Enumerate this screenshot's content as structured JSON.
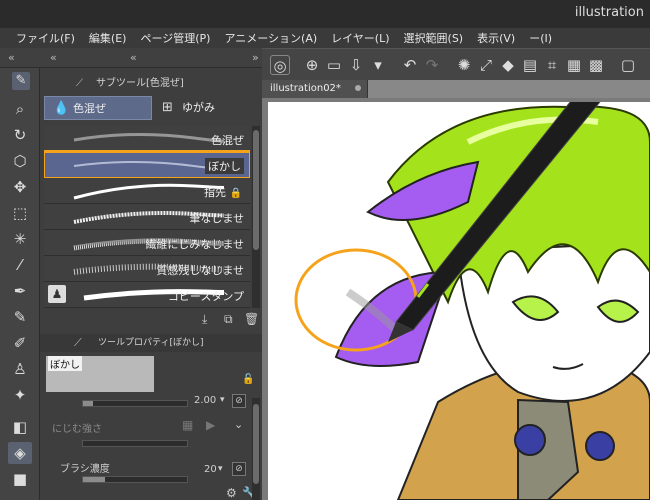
{
  "window": {
    "title": "illustration"
  },
  "menu": [
    "ファイル(F)",
    "編集(E)",
    "ページ管理(P)",
    "アニメーション(A)",
    "レイヤー(L)",
    "選択範囲(S)",
    "表示(V)",
    "ー(I)"
  ],
  "subtool_panel": {
    "title": "サブツール[色混ぜ]",
    "groups": [
      {
        "label": "色混ぜ",
        "icon": "droplets-icon",
        "selected": true
      },
      {
        "label": "ゆがみ",
        "icon": "grid-icon",
        "selected": false
      }
    ],
    "brushes": [
      {
        "name": "色混ぜ"
      },
      {
        "name": "ぼかし",
        "selected": true
      },
      {
        "name": "指先"
      },
      {
        "name": "筆なじませ"
      },
      {
        "name": "繊維にじみなじませ"
      },
      {
        "name": "質感残しなじませ"
      },
      {
        "name": "コピースタンプ"
      }
    ]
  },
  "tool_property": {
    "title": "ツールプロパティ[ぼかし]",
    "brush_name": "ぼかし",
    "brush_size_value": "2.00",
    "blur_strength_label": "にじむ強さ",
    "brush_density_label": "ブラシ濃度",
    "brush_density_value": "20"
  },
  "canvas": {
    "tab_label": "illustration02*"
  },
  "colors": {
    "highlight": "#f6a31c",
    "hair": "#a4e31b",
    "bandana": "#a55cf0",
    "hood": "#d3a24c",
    "eye": "#3a3fa4"
  }
}
